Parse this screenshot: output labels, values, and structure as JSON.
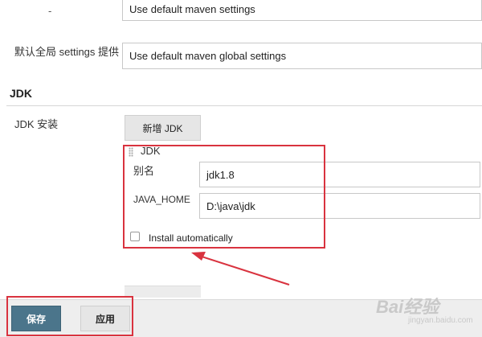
{
  "settings": {
    "top_label": "-",
    "top_value": "Use default maven settings",
    "global_label": "默认全局 settings 提供",
    "global_value": "Use default maven global settings"
  },
  "jdk_section": {
    "title": "JDK",
    "install_label": "JDK 安装",
    "add_button": "新增 JDK",
    "sub_title": "JDK",
    "alias_label": "别名",
    "alias_value": "jdk1.8",
    "home_label": "JAVA_HOME",
    "home_value": "D:\\java\\jdk",
    "install_auto_label": "Install automatically",
    "install_auto_checked": false
  },
  "footer": {
    "save_label": "保存",
    "apply_label": "应用"
  },
  "watermark": {
    "text": "Bai经验",
    "domain": "jingyan.baidu.com"
  },
  "colors": {
    "highlight": "#d9333f",
    "save_button": "#4b758b"
  }
}
